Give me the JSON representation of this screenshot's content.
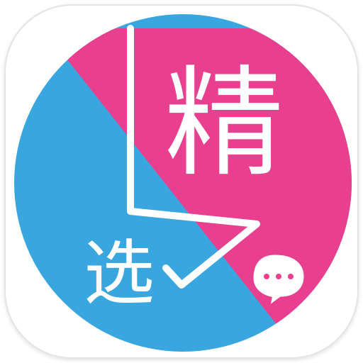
{
  "app_icon": {
    "characters": {
      "primary": "精",
      "secondary": "选"
    },
    "icons": {
      "accent_shape": "chat-bubble-icon"
    },
    "colors": {
      "blue": "#3aa6df",
      "pink": "#e8408e",
      "stroke": "#ffffff",
      "tile_border": "#e4e4e4"
    }
  }
}
